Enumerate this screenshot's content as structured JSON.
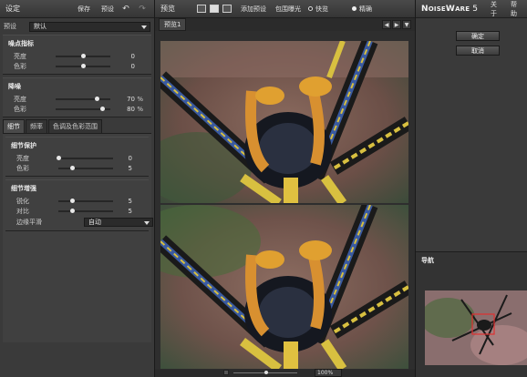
{
  "left": {
    "title": "设定",
    "save": "保存",
    "preset_btn": "预设",
    "preset_label": "预设",
    "preset_value": "默认",
    "noise_level": {
      "head": "噪点指标",
      "rows": [
        {
          "name": "亮度",
          "value": "0",
          "pos": 0.5
        },
        {
          "name": "色彩",
          "value": "0",
          "pos": 0.5
        }
      ]
    },
    "noise_reduction": {
      "head": "降噪",
      "rows": [
        {
          "name": "亮度",
          "value": "70",
          "unit": "%",
          "pos": 0.75
        },
        {
          "name": "色彩",
          "value": "80",
          "unit": "%",
          "pos": 0.85
        }
      ]
    },
    "tabs": [
      "细节",
      "频率",
      "色调及色彩范围"
    ],
    "detail_protection": {
      "head": "细节保护",
      "rows": [
        {
          "name": "亮度",
          "value": "0",
          "pos": 0.0
        },
        {
          "name": "色彩",
          "value": "5",
          "pos": 0.25
        }
      ]
    },
    "detail_enhance": {
      "head": "细节增强",
      "rows": [
        {
          "name": "锐化",
          "value": "5",
          "pos": 0.25
        },
        {
          "name": "对比",
          "value": "5",
          "pos": 0.25
        }
      ],
      "edge_label": "边缘平滑",
      "edge_value": "自动"
    }
  },
  "center": {
    "title": "预览",
    "add_preset": "添加预设",
    "bracket": "包围曝光",
    "fast": "快览",
    "precise": "精确",
    "preview_tab": "预览1",
    "zoom_value": "100%"
  },
  "right": {
    "brand_big1": "N",
    "brand_small": "OISE",
    "brand_big2": "W",
    "brand_small2": "ARE",
    "version": "5",
    "about": "关于",
    "help": "帮助",
    "ok": "确定",
    "cancel": "取消",
    "navigator": "导航"
  }
}
